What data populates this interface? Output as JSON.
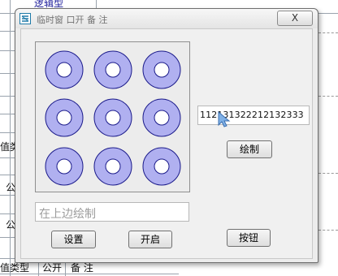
{
  "background_doc": {
    "top_text": "逻辑型",
    "side_texts": [
      "值类",
      "公",
      "公"
    ],
    "bottom_row": [
      "值类型",
      "公开",
      "备 注"
    ]
  },
  "dialog": {
    "title": "临时窗 口开 备 注",
    "close_label": "X",
    "hint_text": "在上边绘制",
    "sequence_value": "112131322212132333",
    "draw_button": "绘制",
    "settings_button": "设置",
    "start_button": "开启",
    "button_label": "按钮"
  },
  "colors": {
    "ring_fill": "#b0b0f0",
    "ring_stroke": "#1a1a8a",
    "canvas_bg": "#ececec"
  }
}
